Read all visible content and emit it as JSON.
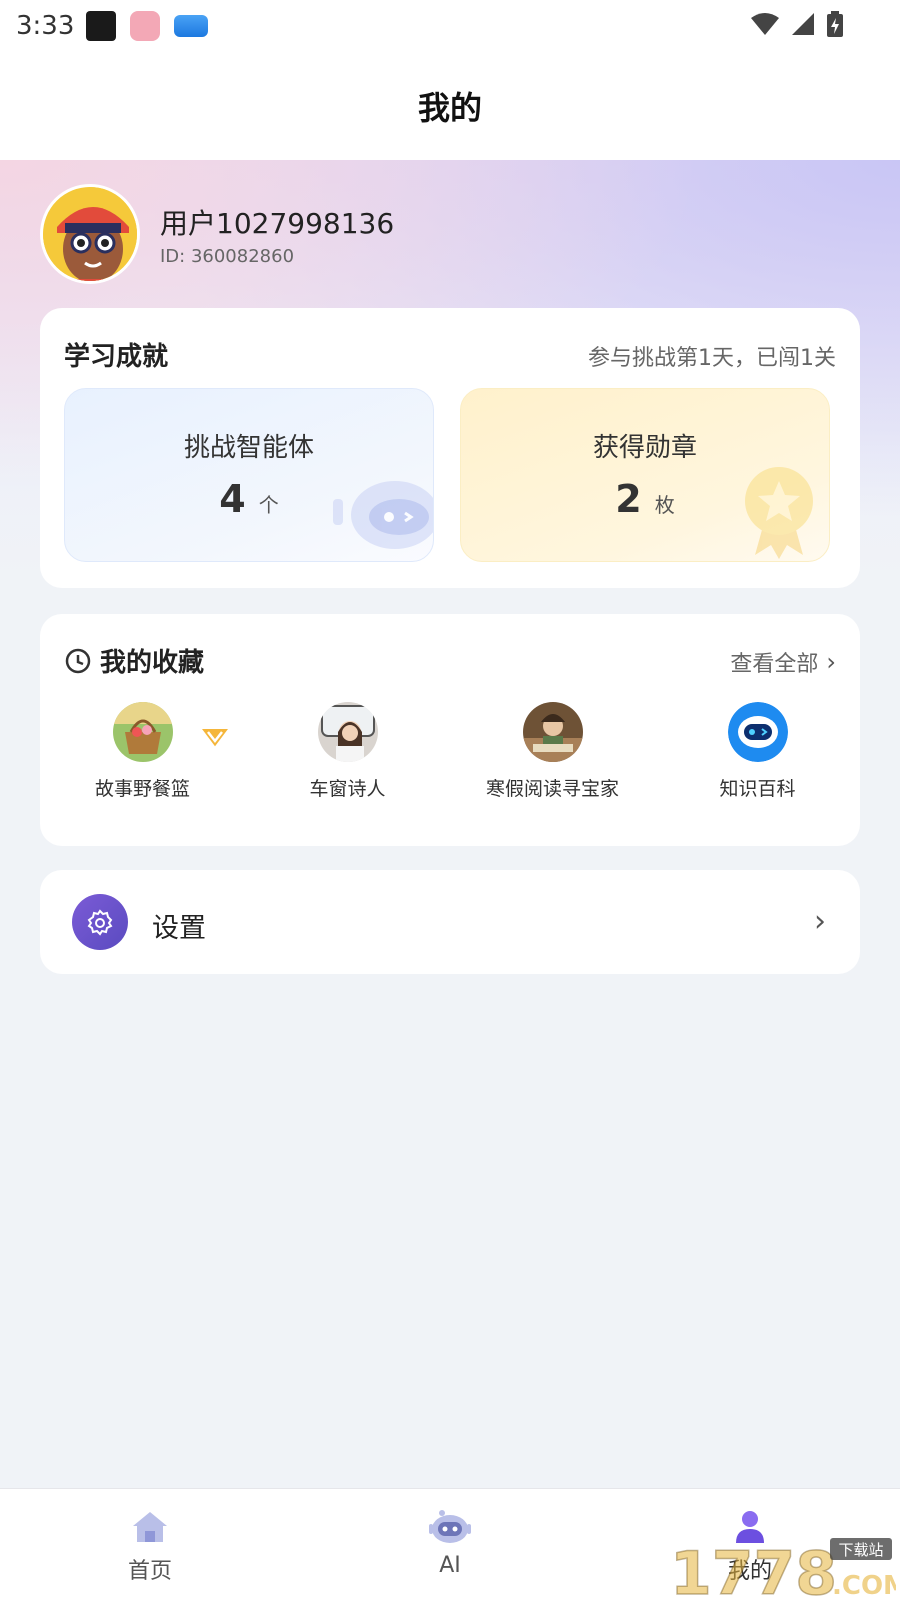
{
  "status_bar": {
    "time": "3:33"
  },
  "header": {
    "title": "我的"
  },
  "profile": {
    "username": "用户1027998136",
    "user_id": "ID: 360082860"
  },
  "achievements": {
    "title": "学习成就",
    "summary": "参与挑战第1天，已闯1关",
    "stats": [
      {
        "label": "挑战智能体",
        "value": "4",
        "unit": "个"
      },
      {
        "label": "获得勋章",
        "value": "2",
        "unit": "枚"
      }
    ]
  },
  "favorites": {
    "title": "我的收藏",
    "view_all": "查看全部",
    "items": [
      {
        "label": "故事野餐篮"
      },
      {
        "label": "车窗诗人"
      },
      {
        "label": "寒假阅读寻宝家"
      },
      {
        "label": "知识百科"
      }
    ]
  },
  "settings": {
    "label": "设置"
  },
  "tabbar": {
    "items": [
      {
        "label": "首页"
      },
      {
        "label": "AI"
      },
      {
        "label": "我的"
      }
    ]
  },
  "watermark": {
    "text": "1778",
    "sub": "下载站",
    "domain": ".COM"
  },
  "colors": {
    "accent": "#6c5ce7",
    "page_bg": "#f0f3f7",
    "card_bg": "#ffffff"
  }
}
